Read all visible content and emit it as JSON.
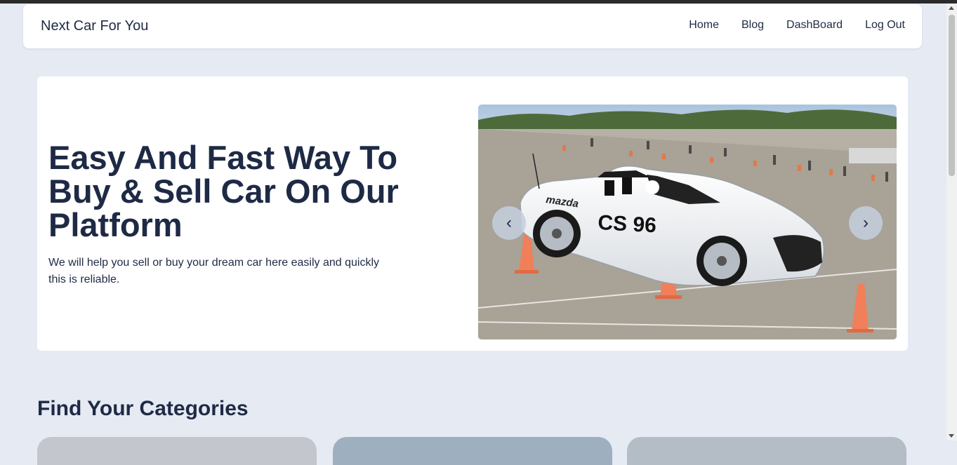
{
  "navbar": {
    "brand": "Next Car For You",
    "links": [
      "Home",
      "Blog",
      "DashBoard",
      "Log Out"
    ]
  },
  "hero": {
    "title": "Easy And Fast Way To Buy & Sell Car On Our Platform",
    "subtitle": "We will help you sell or buy your dream car here easily and quickly this is reliable.",
    "car_brand": "mazda",
    "car_number": "CS 96",
    "prev_symbol": "‹",
    "next_symbol": "›"
  },
  "categories": {
    "title": "Find Your Categories"
  },
  "colors": {
    "page_bg": "#e5eaf3",
    "card_bg": "#ffffff",
    "text_dark": "#1e2a45",
    "carousel_button": "#c4cfde"
  }
}
